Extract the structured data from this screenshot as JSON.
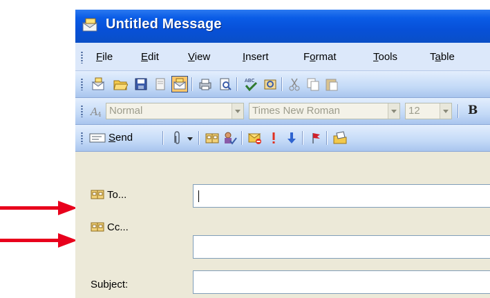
{
  "window": {
    "title": "Untitled Message"
  },
  "menu": [
    {
      "pre": "",
      "u": "F",
      "post": "ile"
    },
    {
      "pre": "",
      "u": "E",
      "post": "dit"
    },
    {
      "pre": "",
      "u": "V",
      "post": "iew"
    },
    {
      "pre": "",
      "u": "I",
      "post": "nsert"
    },
    {
      "pre": "F",
      "u": "o",
      "post": "rmat"
    },
    {
      "pre": "",
      "u": "T",
      "post": "ools"
    },
    {
      "pre": "T",
      "u": "a",
      "post": "ble"
    }
  ],
  "format_toolbar": {
    "style": "Normal",
    "font": "Times New Roman",
    "size": "12",
    "bold": "B"
  },
  "send_toolbar": {
    "send_pre": "",
    "send_u": "S",
    "send_post": "end"
  },
  "fields": {
    "to_label": "To...",
    "cc_label": "Cc...",
    "subject_label": "Subject:",
    "to_value": "",
    "cc_value": "",
    "subject_value": ""
  },
  "colors": {
    "title_bar": "#0A5CE6",
    "annotation_arrow": "#E8001C"
  }
}
